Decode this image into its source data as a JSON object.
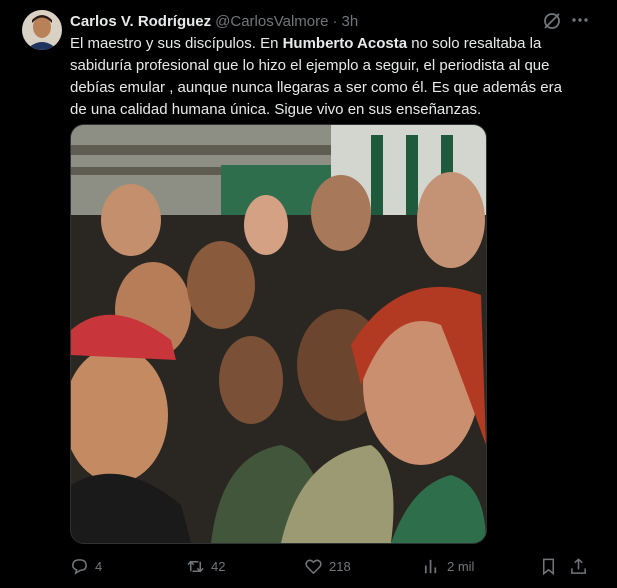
{
  "tweet": {
    "author_name": "Carlos V. Rodríguez",
    "author_handle": "@CarlosValmore",
    "separator": "·",
    "time": "3h",
    "text_part1": "El maestro y sus discípulos. En ",
    "text_bold": "Humberto Acosta",
    "text_part2": " no solo resaltaba la sabiduría profesional que lo hizo el ejemplo a seguir, el periodista al que debías emular , aunque nunca llegaras a ser como él. Es que además era de una calidad humana única. Sigue vivo en sus enseñanzas."
  },
  "actions": {
    "replies": "4",
    "reposts": "42",
    "likes": "218",
    "views": "2 mil"
  },
  "icons": {
    "grok": "grok-icon",
    "more": "more-icon",
    "reply": "reply-icon",
    "repost": "repost-icon",
    "like": "heart-icon",
    "views": "views-icon",
    "bookmark": "bookmark-icon",
    "share": "share-icon"
  },
  "colors": {
    "background": "#000000",
    "text": "#e7e9ea",
    "muted": "#71767b"
  }
}
